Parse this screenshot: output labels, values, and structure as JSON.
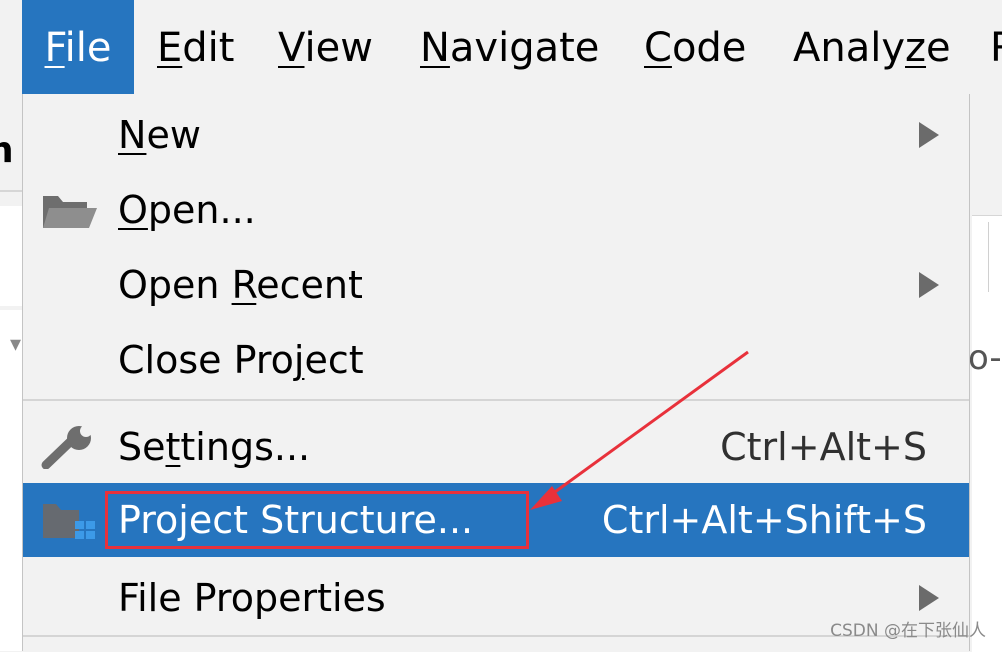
{
  "menubar": {
    "items": [
      {
        "pre": "",
        "mn": "F",
        "post": "ile"
      },
      {
        "pre": "",
        "mn": "E",
        "post": "dit"
      },
      {
        "pre": "",
        "mn": "V",
        "post": "iew"
      },
      {
        "pre": "",
        "mn": "N",
        "post": "avigate"
      },
      {
        "pre": "",
        "mn": "C",
        "post": "ode"
      },
      {
        "pre": "Analy",
        "mn": "z",
        "post": "e"
      },
      {
        "pre": "",
        "mn": "",
        "post": "R"
      }
    ]
  },
  "background": {
    "left_partial_text": "h",
    "right_partial_text": "o-"
  },
  "file_menu": {
    "new": {
      "pre": "",
      "mn": "N",
      "post": "ew"
    },
    "open": {
      "pre": "",
      "mn": "O",
      "post": "pen..."
    },
    "open_recent": {
      "pre": "Open ",
      "mn": "R",
      "post": "ecent"
    },
    "close_project": {
      "pre": "Close Pro",
      "mn": "j",
      "post": "ect"
    },
    "settings": {
      "pre": "Se",
      "mn": "t",
      "post": "tings...",
      "shortcut": "Ctrl+Alt+S"
    },
    "project_structure": {
      "pre": "Project Structure...",
      "mn": "",
      "post": "",
      "shortcut": "Ctrl+Alt+Shift+S"
    },
    "file_properties": {
      "pre": "File Properties",
      "mn": "",
      "post": ""
    }
  },
  "icons": {
    "open": "folder-open-icon",
    "settings": "wrench-icon",
    "project_structure": "project-structure-icon"
  },
  "colors": {
    "selection": "#2675bf",
    "annotation": "#e8313b"
  },
  "watermark": "CSDN @在下张仙人"
}
